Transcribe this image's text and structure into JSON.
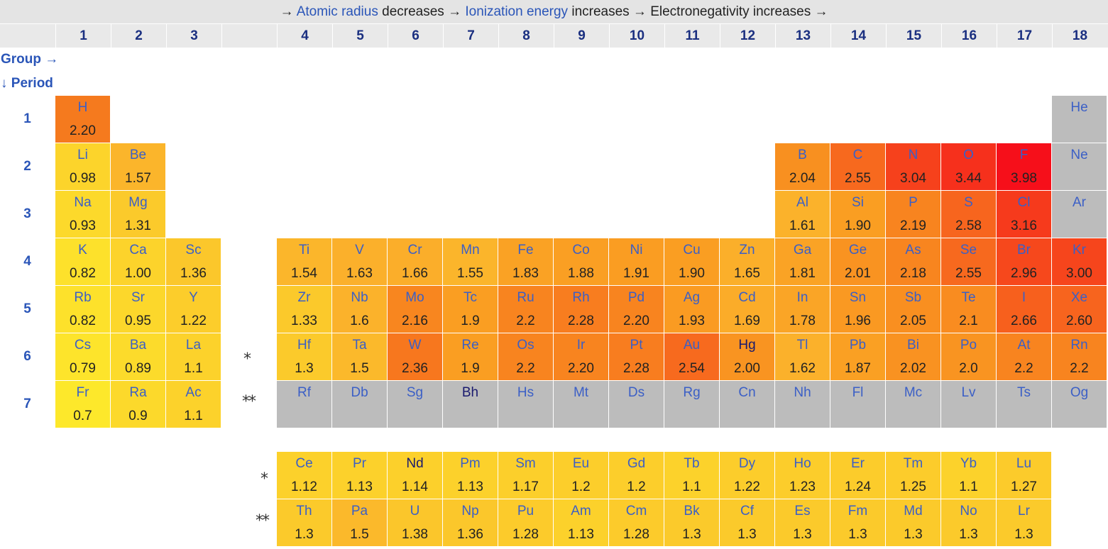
{
  "header": {
    "p1": "→ ",
    "link1": "Atomic radius",
    "p2": " decreases → ",
    "link2": "Ionization energy",
    "p3": " increases → Electronegativity increases →"
  },
  "groups": [
    "1",
    "2",
    "3",
    "",
    "4",
    "5",
    "6",
    "7",
    "8",
    "9",
    "10",
    "11",
    "12",
    "13",
    "14",
    "15",
    "16",
    "17",
    "18"
  ],
  "axis": {
    "group_label": "Group →",
    "period_label": "↓ Period"
  },
  "periods": [
    "1",
    "2",
    "3",
    "4",
    "5",
    "6",
    "7"
  ],
  "markers": {
    "lanthanide": "*",
    "actinide": "**"
  },
  "colors": {
    "yellow": "#fde52b",
    "red": "#f60f1a",
    "gray": "#bcbcbc"
  },
  "elements": [
    {
      "sym": "H",
      "val": "2.20",
      "col": 1,
      "row": 1,
      "color": "#f57a1e"
    },
    {
      "sym": "He",
      "val": "",
      "col": 18,
      "row": 1,
      "color": "#bcbcbc"
    },
    {
      "sym": "Li",
      "val": "0.98",
      "col": 1,
      "row": 2,
      "color": "#fcd42b"
    },
    {
      "sym": "Be",
      "val": "1.57",
      "col": 2,
      "row": 2,
      "color": "#fbb52b"
    },
    {
      "sym": "B",
      "val": "2.04",
      "col": 13,
      "row": 2,
      "color": "#f89020"
    },
    {
      "sym": "C",
      "val": "2.55",
      "col": 14,
      "row": 2,
      "color": "#f7691e"
    },
    {
      "sym": "N",
      "val": "3.04",
      "col": 15,
      "row": 2,
      "color": "#f6411c"
    },
    {
      "sym": "O",
      "val": "3.44",
      "col": 16,
      "row": 2,
      "color": "#f6301c"
    },
    {
      "sym": "F",
      "val": "3.98",
      "col": 17,
      "row": 2,
      "color": "#f60f1a"
    },
    {
      "sym": "Ne",
      "val": "",
      "col": 18,
      "row": 2,
      "color": "#bcbcbc"
    },
    {
      "sym": "Na",
      "val": "0.93",
      "col": 1,
      "row": 3,
      "color": "#fcd92b"
    },
    {
      "sym": "Mg",
      "val": "1.31",
      "col": 2,
      "row": 3,
      "color": "#fbca2b"
    },
    {
      "sym": "Al",
      "val": "1.61",
      "col": 13,
      "row": 3,
      "color": "#fbb22b"
    },
    {
      "sym": "Si",
      "val": "1.90",
      "col": 14,
      "row": 3,
      "color": "#fa9e22"
    },
    {
      "sym": "P",
      "val": "2.19",
      "col": 15,
      "row": 3,
      "color": "#f8841f"
    },
    {
      "sym": "S",
      "val": "2.58",
      "col": 16,
      "row": 3,
      "color": "#f7651e"
    },
    {
      "sym": "Cl",
      "val": "3.16",
      "col": 17,
      "row": 3,
      "color": "#f63a1c"
    },
    {
      "sym": "Ar",
      "val": "",
      "col": 18,
      "row": 3,
      "color": "#bcbcbc"
    },
    {
      "sym": "K",
      "val": "0.82",
      "col": 1,
      "row": 4,
      "color": "#fde12b"
    },
    {
      "sym": "Ca",
      "val": "1.00",
      "col": 2,
      "row": 4,
      "color": "#fcd32b"
    },
    {
      "sym": "Sc",
      "val": "1.36",
      "col": 3,
      "row": 4,
      "color": "#fbc72b"
    },
    {
      "sym": "Ti",
      "val": "1.54",
      "col": 4,
      "row": 4,
      "color": "#fbb62b"
    },
    {
      "sym": "V",
      "val": "1.63",
      "col": 5,
      "row": 4,
      "color": "#fbb02b"
    },
    {
      "sym": "Cr",
      "val": "1.66",
      "col": 6,
      "row": 4,
      "color": "#fbae2a"
    },
    {
      "sym": "Mn",
      "val": "1.55",
      "col": 7,
      "row": 4,
      "color": "#fbb52b"
    },
    {
      "sym": "Fe",
      "val": "1.83",
      "col": 8,
      "row": 4,
      "color": "#faa224"
    },
    {
      "sym": "Co",
      "val": "1.88",
      "col": 9,
      "row": 4,
      "color": "#fa9f23"
    },
    {
      "sym": "Ni",
      "val": "1.91",
      "col": 10,
      "row": 4,
      "color": "#fa9d22"
    },
    {
      "sym": "Cu",
      "val": "1.90",
      "col": 11,
      "row": 4,
      "color": "#fa9e22"
    },
    {
      "sym": "Zn",
      "val": "1.65",
      "col": 12,
      "row": 4,
      "color": "#fbaf2a"
    },
    {
      "sym": "Ga",
      "val": "1.81",
      "col": 13,
      "row": 4,
      "color": "#faa325"
    },
    {
      "sym": "Ge",
      "val": "2.01",
      "col": 14,
      "row": 4,
      "color": "#f99321"
    },
    {
      "sym": "As",
      "val": "2.18",
      "col": 15,
      "row": 4,
      "color": "#f8851f"
    },
    {
      "sym": "Se",
      "val": "2.55",
      "col": 16,
      "row": 4,
      "color": "#f7691e"
    },
    {
      "sym": "Br",
      "val": "2.96",
      "col": 17,
      "row": 4,
      "color": "#f6481c"
    },
    {
      "sym": "Kr",
      "val": "3.00",
      "col": 18,
      "row": 4,
      "color": "#f6451c"
    },
    {
      "sym": "Rb",
      "val": "0.82",
      "col": 1,
      "row": 5,
      "color": "#fde12b"
    },
    {
      "sym": "Sr",
      "val": "0.95",
      "col": 2,
      "row": 5,
      "color": "#fcd72b"
    },
    {
      "sym": "Y",
      "val": "1.22",
      "col": 3,
      "row": 5,
      "color": "#fccd2b"
    },
    {
      "sym": "Zr",
      "val": "1.33",
      "col": 4,
      "row": 5,
      "color": "#fbc92b"
    },
    {
      "sym": "Nb",
      "val": "1.6",
      "col": 5,
      "row": 5,
      "color": "#fbb22b"
    },
    {
      "sym": "Mo",
      "val": "2.16",
      "col": 6,
      "row": 5,
      "color": "#f8861f"
    },
    {
      "sym": "Tc",
      "val": "1.9",
      "col": 7,
      "row": 5,
      "color": "#fa9e22"
    },
    {
      "sym": "Ru",
      "val": "2.2",
      "col": 8,
      "row": 5,
      "color": "#f8841f"
    },
    {
      "sym": "Rh",
      "val": "2.28",
      "col": 9,
      "row": 5,
      "color": "#f87d1f"
    },
    {
      "sym": "Pd",
      "val": "2.20",
      "col": 10,
      "row": 5,
      "color": "#f8841f"
    },
    {
      "sym": "Ag",
      "val": "1.93",
      "col": 11,
      "row": 5,
      "color": "#fa9b22"
    },
    {
      "sym": "Cd",
      "val": "1.69",
      "col": 12,
      "row": 5,
      "color": "#fbac29"
    },
    {
      "sym": "In",
      "val": "1.78",
      "col": 13,
      "row": 5,
      "color": "#faa526"
    },
    {
      "sym": "Sn",
      "val": "1.96",
      "col": 14,
      "row": 5,
      "color": "#fa9922"
    },
    {
      "sym": "Sb",
      "val": "2.05",
      "col": 15,
      "row": 5,
      "color": "#f98f20"
    },
    {
      "sym": "Te",
      "val": "2.1",
      "col": 16,
      "row": 5,
      "color": "#f98c20"
    },
    {
      "sym": "I",
      "val": "2.66",
      "col": 17,
      "row": 5,
      "color": "#f7601d"
    },
    {
      "sym": "Xe",
      "val": "2.60",
      "col": 18,
      "row": 5,
      "color": "#f7641e"
    },
    {
      "sym": "Cs",
      "val": "0.79",
      "col": 1,
      "row": 6,
      "color": "#fde42b"
    },
    {
      "sym": "Ba",
      "val": "0.89",
      "col": 2,
      "row": 6,
      "color": "#fcdb2b"
    },
    {
      "sym": "La",
      "val": "1.1",
      "col": 3,
      "row": 6,
      "color": "#fcd22b"
    },
    {
      "sym": "Hf",
      "val": "1.3",
      "col": 4,
      "row": 6,
      "color": "#fbca2b"
    },
    {
      "sym": "Ta",
      "val": "1.5",
      "col": 5,
      "row": 6,
      "color": "#fbb92b"
    },
    {
      "sym": "W",
      "val": "2.36",
      "col": 6,
      "row": 6,
      "color": "#f7771e"
    },
    {
      "sym": "Re",
      "val": "1.9",
      "col": 7,
      "row": 6,
      "color": "#fa9e22"
    },
    {
      "sym": "Os",
      "val": "2.2",
      "col": 8,
      "row": 6,
      "color": "#f8841f"
    },
    {
      "sym": "Ir",
      "val": "2.20",
      "col": 9,
      "row": 6,
      "color": "#f8841f"
    },
    {
      "sym": "Pt",
      "val": "2.28",
      "col": 10,
      "row": 6,
      "color": "#f87d1f"
    },
    {
      "sym": "Au",
      "val": "2.54",
      "col": 11,
      "row": 6,
      "color": "#f76a1e"
    },
    {
      "sym": "Hg",
      "val": "2.00",
      "col": 12,
      "row": 6,
      "color": "#f99421"
    },
    {
      "sym": "Tl",
      "val": "1.62",
      "col": 13,
      "row": 6,
      "color": "#fbb12b"
    },
    {
      "sym": "Pb",
      "val": "1.87",
      "col": 14,
      "row": 6,
      "color": "#faa023"
    },
    {
      "sym": "Bi",
      "val": "2.02",
      "col": 15,
      "row": 6,
      "color": "#f99221"
    },
    {
      "sym": "Po",
      "val": "2.0",
      "col": 16,
      "row": 6,
      "color": "#f99421"
    },
    {
      "sym": "At",
      "val": "2.2",
      "col": 17,
      "row": 6,
      "color": "#f8841f"
    },
    {
      "sym": "Rn",
      "val": "2.2",
      "col": 18,
      "row": 6,
      "color": "#f8841f"
    },
    {
      "sym": "Fr",
      "val": "0.7",
      "col": 1,
      "row": 7,
      "color": "#fde82b"
    },
    {
      "sym": "Ra",
      "val": "0.9",
      "col": 2,
      "row": 7,
      "color": "#fcd92b"
    },
    {
      "sym": "Ac",
      "val": "1.1",
      "col": 3,
      "row": 7,
      "color": "#fcd22b"
    },
    {
      "sym": "Rf",
      "val": "",
      "col": 4,
      "row": 7,
      "color": "#bcbcbc"
    },
    {
      "sym": "Db",
      "val": "",
      "col": 5,
      "row": 7,
      "color": "#bcbcbc"
    },
    {
      "sym": "Sg",
      "val": "",
      "col": 6,
      "row": 7,
      "color": "#bcbcbc"
    },
    {
      "sym": "Bh",
      "val": "",
      "col": 7,
      "row": 7,
      "color": "#bcbcbc"
    },
    {
      "sym": "Hs",
      "val": "",
      "col": 8,
      "row": 7,
      "color": "#bcbcbc"
    },
    {
      "sym": "Mt",
      "val": "",
      "col": 9,
      "row": 7,
      "color": "#bcbcbc"
    },
    {
      "sym": "Ds",
      "val": "",
      "col": 10,
      "row": 7,
      "color": "#bcbcbc"
    },
    {
      "sym": "Rg",
      "val": "",
      "col": 11,
      "row": 7,
      "color": "#bcbcbc"
    },
    {
      "sym": "Cn",
      "val": "",
      "col": 12,
      "row": 7,
      "color": "#bcbcbc"
    },
    {
      "sym": "Nh",
      "val": "",
      "col": 13,
      "row": 7,
      "color": "#bcbcbc"
    },
    {
      "sym": "Fl",
      "val": "",
      "col": 14,
      "row": 7,
      "color": "#bcbcbc"
    },
    {
      "sym": "Mc",
      "val": "",
      "col": 15,
      "row": 7,
      "color": "#bcbcbc"
    },
    {
      "sym": "Lv",
      "val": "",
      "col": 16,
      "row": 7,
      "color": "#bcbcbc"
    },
    {
      "sym": "Ts",
      "val": "",
      "col": 17,
      "row": 7,
      "color": "#bcbcbc"
    },
    {
      "sym": "Og",
      "val": "",
      "col": 18,
      "row": 7,
      "color": "#bcbcbc"
    }
  ],
  "lanthanides": [
    {
      "sym": "Ce",
      "val": "1.12",
      "color": "#fcd12b"
    },
    {
      "sym": "Pr",
      "val": "1.13",
      "color": "#fcd12b"
    },
    {
      "sym": "Nd",
      "val": "1.14",
      "color": "#fcd02b"
    },
    {
      "sym": "Pm",
      "val": "1.13",
      "color": "#fcd12b"
    },
    {
      "sym": "Sm",
      "val": "1.17",
      "color": "#fccf2b"
    },
    {
      "sym": "Eu",
      "val": "1.2",
      "color": "#fcce2b"
    },
    {
      "sym": "Gd",
      "val": "1.2",
      "color": "#fcce2b"
    },
    {
      "sym": "Tb",
      "val": "1.1",
      "color": "#fcd22b"
    },
    {
      "sym": "Dy",
      "val": "1.22",
      "color": "#fccd2b"
    },
    {
      "sym": "Ho",
      "val": "1.23",
      "color": "#fccd2b"
    },
    {
      "sym": "Er",
      "val": "1.24",
      "color": "#fccc2b"
    },
    {
      "sym": "Tm",
      "val": "1.25",
      "color": "#fccc2b"
    },
    {
      "sym": "Yb",
      "val": "1.1",
      "color": "#fcd22b"
    },
    {
      "sym": "Lu",
      "val": "1.27",
      "color": "#fccb2b"
    }
  ],
  "actinides": [
    {
      "sym": "Th",
      "val": "1.3",
      "color": "#fbca2b"
    },
    {
      "sym": "Pa",
      "val": "1.5",
      "color": "#fbb92b"
    },
    {
      "sym": "U",
      "val": "1.38",
      "color": "#fbc62b"
    },
    {
      "sym": "Np",
      "val": "1.36",
      "color": "#fbc72b"
    },
    {
      "sym": "Pu",
      "val": "1.28",
      "color": "#fccb2b"
    },
    {
      "sym": "Am",
      "val": "1.13",
      "color": "#fcd12b"
    },
    {
      "sym": "Cm",
      "val": "1.28",
      "color": "#fccb2b"
    },
    {
      "sym": "Bk",
      "val": "1.3",
      "color": "#fbca2b"
    },
    {
      "sym": "Cf",
      "val": "1.3",
      "color": "#fbca2b"
    },
    {
      "sym": "Es",
      "val": "1.3",
      "color": "#fbca2b"
    },
    {
      "sym": "Fm",
      "val": "1.3",
      "color": "#fbca2b"
    },
    {
      "sym": "Md",
      "val": "1.3",
      "color": "#fbca2b"
    },
    {
      "sym": "No",
      "val": "1.3",
      "color": "#fbca2b"
    },
    {
      "sym": "Lr",
      "val": "1.3",
      "color": "#fbca2b"
    }
  ]
}
